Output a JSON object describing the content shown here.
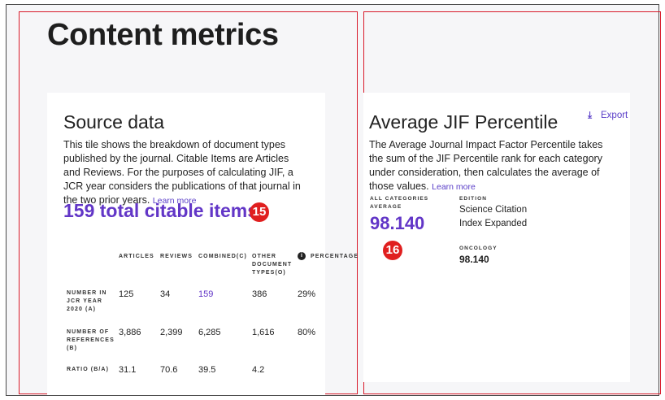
{
  "page": {
    "title": "Content metrics"
  },
  "source_data": {
    "title": "Source data",
    "description": "This tile shows the breakdown of document types published by the journal. Citable Items are Articles and Reviews. For the purposes of calculating JIF, a JCR year considers the publications of that journal in the two prior years.",
    "learn_more": "Learn more",
    "total_label": "159 total citable items",
    "badge": "15",
    "table": {
      "headers": [
        "ARTICLES",
        "REVIEWS",
        "COMBINED(C)",
        "OTHER DOCUMENT TYPES(O)",
        "PERCENTAGE"
      ],
      "rows": [
        {
          "label": "NUMBER IN JCR YEAR 2020 (A)",
          "cells": [
            "125",
            "34",
            "159",
            "386",
            "29%"
          ]
        },
        {
          "label": "NUMBER OF REFERENCES (B)",
          "cells": [
            "3,886",
            "2,399",
            "6,285",
            "1,616",
            "80%"
          ]
        },
        {
          "label": "RATIO (B/A)",
          "cells": [
            "31.1",
            "70.6",
            "39.5",
            "4.2",
            ""
          ]
        }
      ]
    }
  },
  "jif_percentile": {
    "title": "Average JIF Percentile",
    "export_label": "Export",
    "export_icon": "download-icon",
    "description": "The Average Journal Impact Factor Percentile takes the sum of the JIF Percentile rank for each category under consideration, then calculates the average of those values.",
    "learn_more": "Learn more",
    "all_categories_label": "ALL CATEGORIES AVERAGE",
    "all_categories_value": "98.140",
    "edition_label": "EDITION",
    "edition_value": "Science Citation Index Expanded",
    "oncology_label": "ONCOLOGY",
    "oncology_value": "98.140",
    "badge": "16"
  },
  "colors": {
    "accent": "#6236c7",
    "annotation": "#d91a2a",
    "badge": "#e01f1f"
  }
}
